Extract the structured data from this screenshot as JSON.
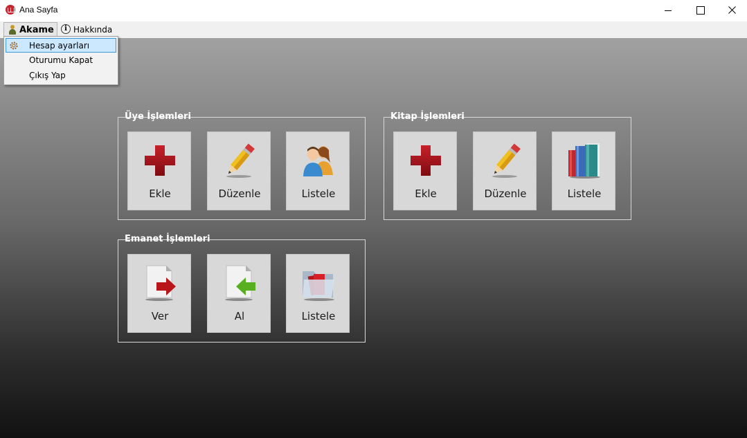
{
  "window": {
    "title": "Ana Sayfa",
    "icon": "book-icon",
    "controls": [
      "minimize-icon",
      "maximize-icon",
      "close-icon"
    ]
  },
  "menubar": {
    "user_menu": {
      "label": "Akame",
      "icon": "user-icon"
    },
    "about_menu": {
      "label": "Hakkında",
      "icon": "info-icon"
    }
  },
  "dropdown": {
    "items": [
      {
        "label": "Hesap ayarları",
        "icon": "gear-icon",
        "highlighted": true
      },
      {
        "label": "Oturumu Kapat"
      },
      {
        "label": "Çıkış Yap"
      }
    ]
  },
  "groups": {
    "uye": {
      "title": "Üye İşlemleri",
      "tiles": [
        {
          "label": "Ekle",
          "icon": "plus-icon"
        },
        {
          "label": "Düzenle",
          "icon": "pencil-icon"
        },
        {
          "label": "Listele",
          "icon": "users-icon"
        }
      ]
    },
    "kitap": {
      "title": "Kitap İşlemleri",
      "tiles": [
        {
          "label": "Ekle",
          "icon": "plus-icon"
        },
        {
          "label": "Düzenle",
          "icon": "pencil-icon"
        },
        {
          "label": "Listele",
          "icon": "books-icon"
        }
      ]
    },
    "emanet": {
      "title": "Emanet İşlemleri",
      "tiles": [
        {
          "label": "Ver",
          "icon": "document-arrow-right-icon"
        },
        {
          "label": "Al",
          "icon": "document-arrow-left-icon"
        },
        {
          "label": "Listele",
          "icon": "folder-icon"
        }
      ]
    }
  },
  "colors": {
    "accent_red": "#a3161a",
    "highlight": "#cce8ff",
    "highlight_border": "#3c99dc",
    "group_border": "#d8d8d8",
    "tile_bg": "#d8d8d8"
  }
}
